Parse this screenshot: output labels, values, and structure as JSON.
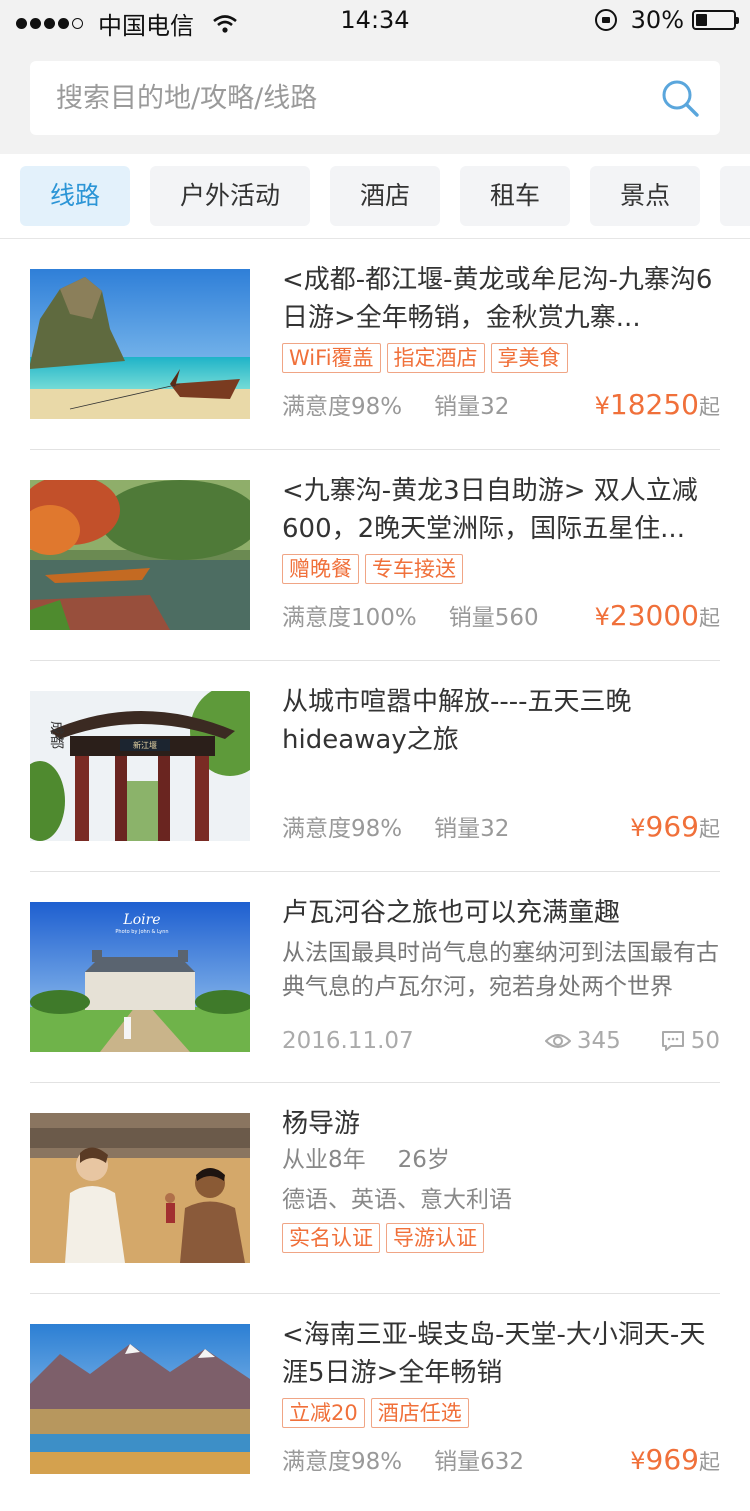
{
  "status": {
    "carrier": "中国电信",
    "time": "14:34",
    "battery": "30%",
    "battery_level": 0.3
  },
  "search": {
    "placeholder": "搜索目的地/攻略/线路",
    "value": ""
  },
  "tabs": [
    {
      "label": "线路",
      "active": true
    },
    {
      "label": "户外活动",
      "active": false
    },
    {
      "label": "酒店",
      "active": false
    },
    {
      "label": "租车",
      "active": false
    },
    {
      "label": "景点",
      "active": false
    }
  ],
  "items": [
    {
      "title": "<成都-都江堰-黄龙或牟尼沟-九寨沟6日游>全年畅销，金秋赏九寨...",
      "tags": [
        "WiFi覆盖",
        "指定酒店",
        "享美食"
      ],
      "satisfaction": "满意度98%",
      "sales": "销量32",
      "price_symbol": "¥",
      "price": "18250",
      "price_suffix": "起"
    },
    {
      "title": "<九寨沟-黄龙3日自助游> 双人立减600，2晚天堂洲际，国际五星住...",
      "tags": [
        "赠晚餐",
        "专车接送"
      ],
      "satisfaction": "满意度100%",
      "sales": "销量560",
      "price_symbol": "¥",
      "price": "23000",
      "price_suffix": "起"
    },
    {
      "title": "从城市喧嚣中解放----五天三晚hideaway之旅",
      "satisfaction": "满意度98%",
      "sales": "销量32",
      "price_symbol": "¥",
      "price": "969",
      "price_suffix": "起"
    },
    {
      "title": "卢瓦河谷之旅也可以充满童趣",
      "description": "从法国最具时尚气息的塞纳河到法国最有古典气息的卢瓦尔河，宛若身处两个世界",
      "date": "2016.11.07",
      "views": "345",
      "comments": "50",
      "image_text": "Loire",
      "image_subtext": "Photo by John & Lynn"
    },
    {
      "name": "杨导游",
      "experience": "从业8年",
      "age": "26岁",
      "languages": "德语、英语、意大利语",
      "tags": [
        "实名认证",
        "导游认证"
      ]
    },
    {
      "title": "<海南三亚-蜈支岛-天堂-大小洞天-天涯5日游>全年畅销",
      "tags": [
        "立减20",
        "酒店任选"
      ],
      "satisfaction": "满意度98%",
      "sales": "销量632",
      "price_symbol": "¥",
      "price": "969",
      "price_suffix": "起"
    }
  ],
  "image_labels": {
    "gate_calligraphy": "成都",
    "gate_plaque": "新江堰"
  },
  "colors": {
    "accent": "#2c95d6",
    "price": "#f0703a",
    "tag_border": "#f0a585"
  }
}
